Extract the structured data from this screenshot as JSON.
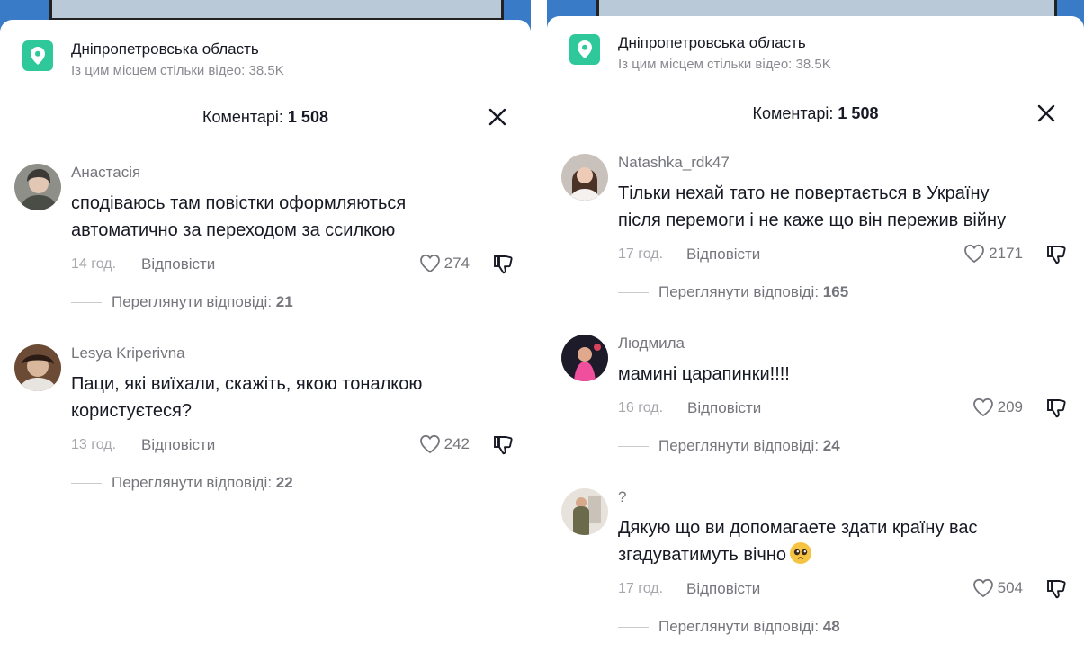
{
  "left": {
    "location": {
      "title": "Дніпропетровська область",
      "subtitle": "Із цим місцем стільки відео: 38.5K"
    },
    "header": {
      "prefix": "Коментарі: ",
      "count": "1 508"
    },
    "comments": [
      {
        "user": "Анастасія",
        "text1": "сподіваюсь там повістки оформляються",
        "text2": "автоматично за переходом за ссилкою",
        "time": "14 год.",
        "reply": "Відповісти",
        "likes": "274",
        "view_prefix": "Переглянути відповіді: ",
        "view_count": "21"
      },
      {
        "user": "Lesya Kriperivna",
        "text1": "Паци, які виїхали, скажіть, якою тоналкою",
        "text2": "користуєтеся?",
        "time": "13 год.",
        "reply": "Відповісти",
        "likes": "242",
        "view_prefix": "Переглянути відповіді: ",
        "view_count": "22"
      }
    ]
  },
  "right": {
    "location": {
      "title": "Дніпропетровська область",
      "subtitle": "Із цим місцем стільки відео: 38.5K"
    },
    "header": {
      "prefix": "Коментарі: ",
      "count": "1 508"
    },
    "comments": [
      {
        "user": "Natashka_rdk47",
        "text1": "Тільки нехай тато не повертається в Україну",
        "text2": "після перемоги і не каже що він пережив війну",
        "time": "17 год.",
        "reply": "Відповісти",
        "likes": "2171",
        "view_prefix": "Переглянути відповіді: ",
        "view_count": "165"
      },
      {
        "user": "Людмила",
        "text1": "мамині царапинки!!!!",
        "text2": "",
        "time": "16 год.",
        "reply": "Відповісти",
        "likes": "209",
        "view_prefix": "Переглянути відповіді: ",
        "view_count": "24"
      },
      {
        "user": "?",
        "text1": "Дякую що ви допомагаете здати країну вас",
        "text2": "згадуватимуть вічно",
        "time": "17 год.",
        "reply": "Відповісти",
        "likes": "504",
        "view_prefix": "Переглянути відповіді: ",
        "view_count": "48"
      }
    ]
  },
  "icons": {
    "location": "location-pin-icon",
    "close": "close-icon",
    "like": "heart-icon",
    "dislike": "thumbs-down-icon",
    "emoji": "pleading-face-emoji-icon"
  },
  "colors": {
    "accent": "#2fc89a",
    "text": "#161823",
    "muted": "#8a8b91"
  }
}
